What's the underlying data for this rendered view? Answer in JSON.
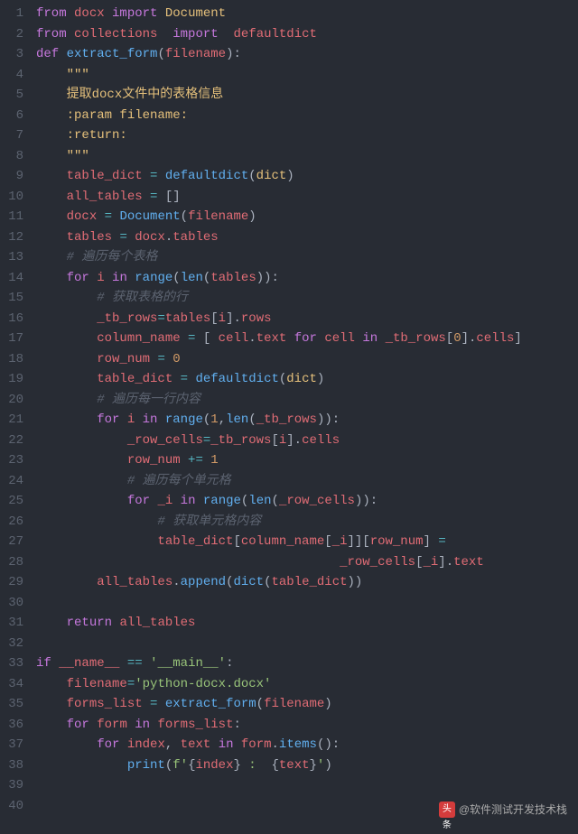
{
  "watermark": {
    "logo_text": "头条",
    "handle": "@软件测试开发技术栈"
  },
  "lines": [
    {
      "n": 1,
      "tokens": [
        [
          "kw",
          "from"
        ],
        [
          "pn",
          " "
        ],
        [
          "var",
          "docx"
        ],
        [
          "pn",
          " "
        ],
        [
          "kw",
          "import"
        ],
        [
          "pn",
          " "
        ],
        [
          "cls",
          "Document"
        ]
      ]
    },
    {
      "n": 2,
      "tokens": [
        [
          "kw",
          "from"
        ],
        [
          "pn",
          " "
        ],
        [
          "var",
          "collections"
        ],
        [
          "pn",
          "  "
        ],
        [
          "kw",
          "import"
        ],
        [
          "pn",
          "  "
        ],
        [
          "var",
          "defaultdict"
        ]
      ]
    },
    {
      "n": 3,
      "tokens": [
        [
          "kw",
          "def"
        ],
        [
          "pn",
          " "
        ],
        [
          "fn",
          "extract_form"
        ],
        [
          "pn",
          "("
        ],
        [
          "var",
          "filename"
        ],
        [
          "pn",
          "):"
        ]
      ]
    },
    {
      "n": 4,
      "tokens": [
        [
          "pn",
          "    "
        ],
        [
          "doc",
          "\"\"\""
        ]
      ]
    },
    {
      "n": 5,
      "tokens": [
        [
          "pn",
          "    "
        ],
        [
          "doc",
          "提取docx文件中的表格信息"
        ]
      ]
    },
    {
      "n": 6,
      "tokens": [
        [
          "pn",
          "    "
        ],
        [
          "doc",
          ":param filename:"
        ]
      ]
    },
    {
      "n": 7,
      "tokens": [
        [
          "pn",
          "    "
        ],
        [
          "doc",
          ":return:"
        ]
      ]
    },
    {
      "n": 8,
      "tokens": [
        [
          "pn",
          "    "
        ],
        [
          "doc",
          "\"\"\""
        ]
      ]
    },
    {
      "n": 9,
      "tokens": [
        [
          "pn",
          "    "
        ],
        [
          "var",
          "table_dict"
        ],
        [
          "pn",
          " "
        ],
        [
          "op",
          "="
        ],
        [
          "pn",
          " "
        ],
        [
          "fn",
          "defaultdict"
        ],
        [
          "pn",
          "("
        ],
        [
          "cls",
          "dict"
        ],
        [
          "pn",
          ")"
        ]
      ]
    },
    {
      "n": 10,
      "tokens": [
        [
          "pn",
          "    "
        ],
        [
          "var",
          "all_tables"
        ],
        [
          "pn",
          " "
        ],
        [
          "op",
          "="
        ],
        [
          "pn",
          " []"
        ]
      ]
    },
    {
      "n": 11,
      "tokens": [
        [
          "pn",
          "    "
        ],
        [
          "var",
          "docx"
        ],
        [
          "pn",
          " "
        ],
        [
          "op",
          "="
        ],
        [
          "pn",
          " "
        ],
        [
          "fn",
          "Document"
        ],
        [
          "pn",
          "("
        ],
        [
          "var",
          "filename"
        ],
        [
          "pn",
          ")"
        ]
      ]
    },
    {
      "n": 12,
      "tokens": [
        [
          "pn",
          "    "
        ],
        [
          "var",
          "tables"
        ],
        [
          "pn",
          " "
        ],
        [
          "op",
          "="
        ],
        [
          "pn",
          " "
        ],
        [
          "var",
          "docx"
        ],
        [
          "pn",
          "."
        ],
        [
          "attr",
          "tables"
        ]
      ]
    },
    {
      "n": 13,
      "tokens": [
        [
          "pn",
          "    "
        ],
        [
          "com",
          "# 遍历每个表格"
        ]
      ]
    },
    {
      "n": 14,
      "tokens": [
        [
          "pn",
          "    "
        ],
        [
          "kw",
          "for"
        ],
        [
          "pn",
          " "
        ],
        [
          "var",
          "i"
        ],
        [
          "pn",
          " "
        ],
        [
          "kw",
          "in"
        ],
        [
          "pn",
          " "
        ],
        [
          "fn",
          "range"
        ],
        [
          "pn",
          "("
        ],
        [
          "fn",
          "len"
        ],
        [
          "pn",
          "("
        ],
        [
          "var",
          "tables"
        ],
        [
          "pn",
          ")):"
        ]
      ]
    },
    {
      "n": 15,
      "tokens": [
        [
          "pn",
          "        "
        ],
        [
          "com",
          "# 获取表格的行"
        ]
      ]
    },
    {
      "n": 16,
      "tokens": [
        [
          "pn",
          "        "
        ],
        [
          "var",
          "_tb_rows"
        ],
        [
          "op",
          "="
        ],
        [
          "var",
          "tables"
        ],
        [
          "pn",
          "["
        ],
        [
          "var",
          "i"
        ],
        [
          "pn",
          "]."
        ],
        [
          "attr",
          "rows"
        ]
      ]
    },
    {
      "n": 17,
      "tokens": [
        [
          "pn",
          "        "
        ],
        [
          "var",
          "column_name"
        ],
        [
          "pn",
          " "
        ],
        [
          "op",
          "="
        ],
        [
          "pn",
          " [ "
        ],
        [
          "var",
          "cell"
        ],
        [
          "pn",
          "."
        ],
        [
          "attr",
          "text"
        ],
        [
          "pn",
          " "
        ],
        [
          "kw",
          "for"
        ],
        [
          "pn",
          " "
        ],
        [
          "var",
          "cell"
        ],
        [
          "pn",
          " "
        ],
        [
          "kw",
          "in"
        ],
        [
          "pn",
          " "
        ],
        [
          "var",
          "_tb_rows"
        ],
        [
          "pn",
          "["
        ],
        [
          "num",
          "0"
        ],
        [
          "pn",
          "]."
        ],
        [
          "attr",
          "cells"
        ],
        [
          "pn",
          "]"
        ]
      ]
    },
    {
      "n": 18,
      "tokens": [
        [
          "pn",
          "        "
        ],
        [
          "var",
          "row_num"
        ],
        [
          "pn",
          " "
        ],
        [
          "op",
          "="
        ],
        [
          "pn",
          " "
        ],
        [
          "num",
          "0"
        ]
      ]
    },
    {
      "n": 19,
      "tokens": [
        [
          "pn",
          "        "
        ],
        [
          "var",
          "table_dict"
        ],
        [
          "pn",
          " "
        ],
        [
          "op",
          "="
        ],
        [
          "pn",
          " "
        ],
        [
          "fn",
          "defaultdict"
        ],
        [
          "pn",
          "("
        ],
        [
          "cls",
          "dict"
        ],
        [
          "pn",
          ")"
        ]
      ]
    },
    {
      "n": 20,
      "tokens": [
        [
          "pn",
          "        "
        ],
        [
          "com",
          "# 遍历每一行内容"
        ]
      ]
    },
    {
      "n": 21,
      "tokens": [
        [
          "pn",
          "        "
        ],
        [
          "kw",
          "for"
        ],
        [
          "pn",
          " "
        ],
        [
          "var",
          "i"
        ],
        [
          "pn",
          " "
        ],
        [
          "kw",
          "in"
        ],
        [
          "pn",
          " "
        ],
        [
          "fn",
          "range"
        ],
        [
          "pn",
          "("
        ],
        [
          "num",
          "1"
        ],
        [
          "pn",
          ","
        ],
        [
          "fn",
          "len"
        ],
        [
          "pn",
          "("
        ],
        [
          "var",
          "_tb_rows"
        ],
        [
          "pn",
          ")):"
        ]
      ]
    },
    {
      "n": 22,
      "tokens": [
        [
          "pn",
          "            "
        ],
        [
          "var",
          "_row_cells"
        ],
        [
          "op",
          "="
        ],
        [
          "var",
          "_tb_rows"
        ],
        [
          "pn",
          "["
        ],
        [
          "var",
          "i"
        ],
        [
          "pn",
          "]."
        ],
        [
          "attr",
          "cells"
        ]
      ]
    },
    {
      "n": 23,
      "tokens": [
        [
          "pn",
          "            "
        ],
        [
          "var",
          "row_num"
        ],
        [
          "pn",
          " "
        ],
        [
          "op",
          "+="
        ],
        [
          "pn",
          " "
        ],
        [
          "num",
          "1"
        ]
      ]
    },
    {
      "n": 24,
      "tokens": [
        [
          "pn",
          "            "
        ],
        [
          "com",
          "# 遍历每个单元格"
        ]
      ]
    },
    {
      "n": 25,
      "tokens": [
        [
          "pn",
          "            "
        ],
        [
          "kw",
          "for"
        ],
        [
          "pn",
          " "
        ],
        [
          "var",
          "_i"
        ],
        [
          "pn",
          " "
        ],
        [
          "kw",
          "in"
        ],
        [
          "pn",
          " "
        ],
        [
          "fn",
          "range"
        ],
        [
          "pn",
          "("
        ],
        [
          "fn",
          "len"
        ],
        [
          "pn",
          "("
        ],
        [
          "var",
          "_row_cells"
        ],
        [
          "pn",
          ")):"
        ]
      ]
    },
    {
      "n": 26,
      "tokens": [
        [
          "pn",
          "                "
        ],
        [
          "com",
          "# 获取单元格内容"
        ]
      ]
    },
    {
      "n": 27,
      "tokens": [
        [
          "pn",
          "                "
        ],
        [
          "var",
          "table_dict"
        ],
        [
          "pn",
          "["
        ],
        [
          "var",
          "column_name"
        ],
        [
          "pn",
          "["
        ],
        [
          "var",
          "_i"
        ],
        [
          "pn",
          "]]["
        ],
        [
          "var",
          "row_num"
        ],
        [
          "pn",
          "] "
        ],
        [
          "op",
          "="
        ]
      ]
    },
    {
      "n": 28,
      "tokens": [
        [
          "pn",
          "                                        "
        ],
        [
          "var",
          "_row_cells"
        ],
        [
          "pn",
          "["
        ],
        [
          "var",
          "_i"
        ],
        [
          "pn",
          "]."
        ],
        [
          "attr",
          "text"
        ]
      ]
    },
    {
      "n": 29,
      "tokens": [
        [
          "pn",
          "        "
        ],
        [
          "var",
          "all_tables"
        ],
        [
          "pn",
          "."
        ],
        [
          "fn",
          "append"
        ],
        [
          "pn",
          "("
        ],
        [
          "fn",
          "dict"
        ],
        [
          "pn",
          "("
        ],
        [
          "var",
          "table_dict"
        ],
        [
          "pn",
          "))"
        ]
      ]
    },
    {
      "n": 30,
      "tokens": []
    },
    {
      "n": 31,
      "tokens": [
        [
          "pn",
          "    "
        ],
        [
          "kw",
          "return"
        ],
        [
          "pn",
          " "
        ],
        [
          "var",
          "all_tables"
        ]
      ]
    },
    {
      "n": 32,
      "tokens": []
    },
    {
      "n": 33,
      "tokens": [
        [
          "kw",
          "if"
        ],
        [
          "pn",
          " "
        ],
        [
          "var",
          "__name__"
        ],
        [
          "pn",
          " "
        ],
        [
          "op",
          "=="
        ],
        [
          "pn",
          " "
        ],
        [
          "str",
          "'__main__'"
        ],
        [
          "pn",
          ":"
        ]
      ]
    },
    {
      "n": 34,
      "tokens": [
        [
          "pn",
          "    "
        ],
        [
          "var",
          "filename"
        ],
        [
          "op",
          "="
        ],
        [
          "str",
          "'python-docx.docx'"
        ]
      ]
    },
    {
      "n": 35,
      "tokens": [
        [
          "pn",
          "    "
        ],
        [
          "var",
          "forms_list"
        ],
        [
          "pn",
          " "
        ],
        [
          "op",
          "="
        ],
        [
          "pn",
          " "
        ],
        [
          "fn",
          "extract_form"
        ],
        [
          "pn",
          "("
        ],
        [
          "var",
          "filename"
        ],
        [
          "pn",
          ")"
        ]
      ]
    },
    {
      "n": 36,
      "tokens": [
        [
          "pn",
          "    "
        ],
        [
          "kw",
          "for"
        ],
        [
          "pn",
          " "
        ],
        [
          "var",
          "form"
        ],
        [
          "pn",
          " "
        ],
        [
          "kw",
          "in"
        ],
        [
          "pn",
          " "
        ],
        [
          "var",
          "forms_list"
        ],
        [
          "pn",
          ":"
        ]
      ]
    },
    {
      "n": 37,
      "tokens": [
        [
          "pn",
          "        "
        ],
        [
          "kw",
          "for"
        ],
        [
          "pn",
          " "
        ],
        [
          "var",
          "index"
        ],
        [
          "pn",
          ", "
        ],
        [
          "var",
          "text"
        ],
        [
          "pn",
          " "
        ],
        [
          "kw",
          "in"
        ],
        [
          "pn",
          " "
        ],
        [
          "var",
          "form"
        ],
        [
          "pn",
          "."
        ],
        [
          "fn",
          "items"
        ],
        [
          "pn",
          "():"
        ]
      ]
    },
    {
      "n": 38,
      "tokens": [
        [
          "pn",
          "            "
        ],
        [
          "fn",
          "print"
        ],
        [
          "pn",
          "("
        ],
        [
          "str",
          "f'"
        ],
        [
          "pn",
          "{"
        ],
        [
          "var",
          "index"
        ],
        [
          "pn",
          "}"
        ],
        [
          "str",
          " :  "
        ],
        [
          "pn",
          "{"
        ],
        [
          "var",
          "text"
        ],
        [
          "pn",
          "}"
        ],
        [
          "str",
          "'"
        ],
        [
          "pn",
          ")"
        ]
      ]
    },
    {
      "n": 39,
      "tokens": []
    },
    {
      "n": 40,
      "tokens": []
    }
  ]
}
